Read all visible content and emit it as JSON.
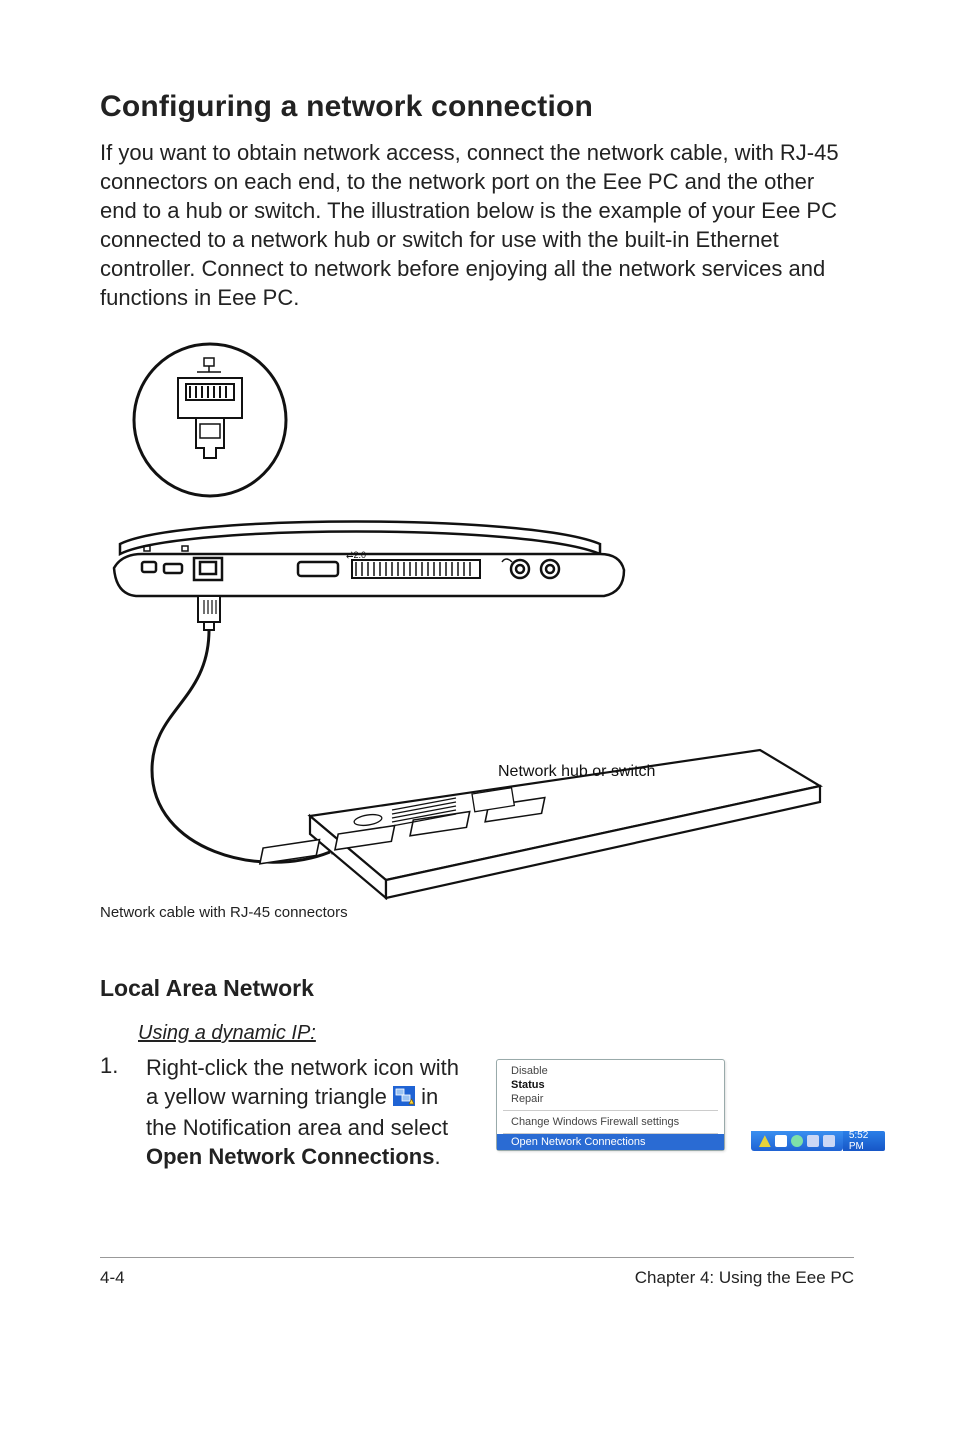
{
  "heading": "Configuring a network connection",
  "intro": "If you want to obtain network access, connect the network cable, with RJ-45 connectors on each end, to the network port on the Eee PC and the other end to a hub or switch. The illustration below is the example of your Eee PC connected to a network hub or switch for use with the built-in Ethernet controller. Connect to network before enjoying all the network services and functions in Eee PC.",
  "diagram": {
    "hub_label": "Network hub or switch"
  },
  "caption": "Network cable with RJ-45 connectors",
  "subhead": "Local Area Network",
  "subsub": "Using a dynamic IP:",
  "step": {
    "num": "1.",
    "t1": "Right-click the network icon with a yellow warning triangle ",
    "t2": " in the Notification area and select ",
    "bold": "Open Network Connections",
    "period": "."
  },
  "context_menu": {
    "disable": "Disable",
    "status": "Status",
    "repair": "Repair",
    "firewall": "Change Windows Firewall settings",
    "open": "Open Network Connections"
  },
  "taskbar": {
    "time": "5:52 PM"
  },
  "footer": {
    "left": "4-4",
    "right": "Chapter 4: Using the Eee PC"
  }
}
